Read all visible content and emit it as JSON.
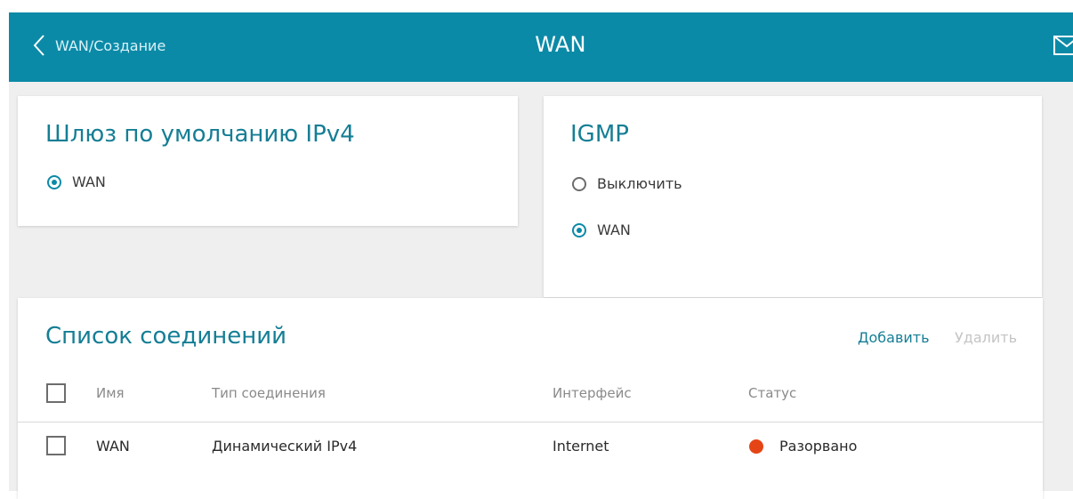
{
  "header": {
    "back_label": "WAN/Создание",
    "title": "WAN"
  },
  "gateway_card": {
    "title": "Шлюз по умолчанию IPv4",
    "options": [
      {
        "label": "WAN",
        "checked": true
      }
    ]
  },
  "igmp_card": {
    "title": "IGMP",
    "options": [
      {
        "label": "Выключить",
        "checked": false
      },
      {
        "label": "WAN",
        "checked": true
      }
    ]
  },
  "connections": {
    "title": "Список соединений",
    "add_label": "Добавить",
    "delete_label": "Удалить",
    "columns": [
      "Имя",
      "Тип соединения",
      "Интерфейс",
      "Статус"
    ],
    "rows": [
      {
        "name": "WAN",
        "type": "Динамический IPv4",
        "interface": "Internet",
        "status": "Разорвано"
      }
    ]
  },
  "colors": {
    "header_bg": "#0b8aa7",
    "accent": "#157e95",
    "status_disconnected": "#e54516"
  },
  "icons": {
    "back": "chevron-left-icon",
    "mail": "mail-icon"
  }
}
